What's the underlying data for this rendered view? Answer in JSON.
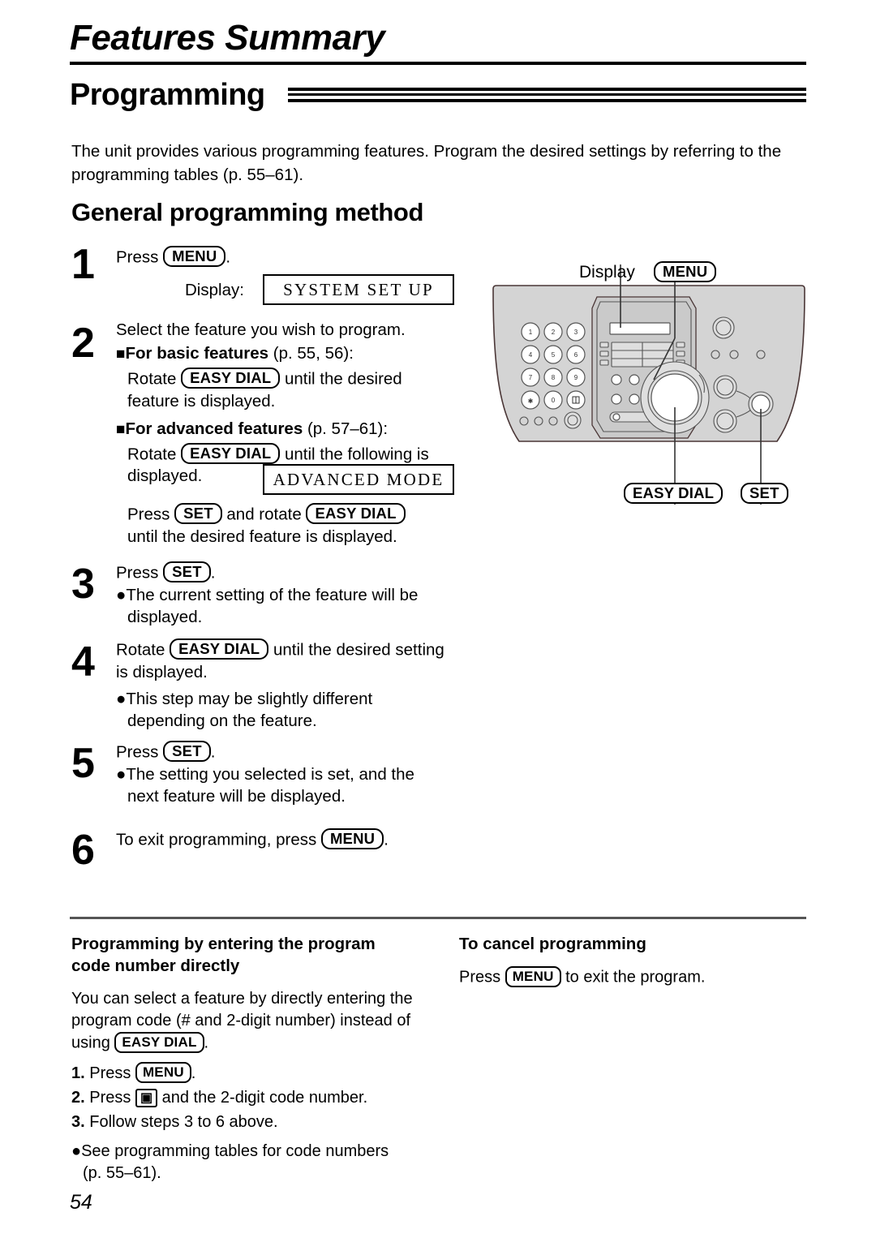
{
  "header": {
    "chapter_title": "Features Summary",
    "section_title": "Programming"
  },
  "intro": {
    "paragraph": "The unit provides various programming features. Program the desired settings by referring to the programming tables (p. 55–61)."
  },
  "subsection": {
    "title": "General programming method"
  },
  "keys": {
    "menu": "MENU",
    "set": "SET",
    "easy_dial": "EASY DIAL",
    "hash": "▣"
  },
  "steps": [
    {
      "number": "1",
      "line1_prefix": "Press",
      "line1_key": "MENU",
      "line1_suffix": ".",
      "display_label": "Display:",
      "display_text": "SYSTEM SET UP"
    },
    {
      "number": "2",
      "line1": "Select the feature you wish to program.",
      "basic_heading": "For basic features",
      "basic_pages": "(p. 55, 56):",
      "basic_l1_prefix": "Rotate",
      "basic_l1_key": "EASY DIAL",
      "basic_l1_suffix": "until the desired",
      "basic_l2": "feature is displayed.",
      "advanced_heading": "For advanced features",
      "advanced_pages": "(p. 57–61):",
      "advanced_l1_prefix": "Rotate",
      "advanced_l1_key": "EASY DIAL",
      "advanced_l1_suffix": "until the following is",
      "advanced_l2": "displayed.",
      "display_text": "ADVANCED MODE",
      "press_prefix": "Press",
      "press_key1": "SET",
      "press_middle": "and rotate",
      "press_key2": "EASY DIAL",
      "press_l2": "until the desired feature is displayed."
    },
    {
      "number": "3",
      "line1_prefix": "Press",
      "line1_key": "SET",
      "line1_suffix": ".",
      "bullet1": "●The current setting of the feature will be",
      "bullet1_cont": "displayed."
    },
    {
      "number": "4",
      "line1_prefix": "Rotate",
      "line1_key": "EASY DIAL",
      "line1_suffix": "until the desired setting",
      "line2": "is displayed.",
      "bullet1": "●This step may be slightly different",
      "bullet1_cont": "depending on the feature."
    },
    {
      "number": "5",
      "line1_prefix": "Press",
      "line1_key": "SET",
      "line1_suffix": ".",
      "bullet1": "●The setting you selected is set, and the",
      "bullet1_cont": "next feature will be displayed."
    },
    {
      "number": "6",
      "line1_prefix": "To exit programming, press",
      "line1_key": "MENU",
      "line1_suffix": "."
    }
  ],
  "device": {
    "callout_display": "Display",
    "callout_menu": "MENU",
    "callout_easy_dial": "EASY DIAL",
    "callout_set": "SET",
    "keypad": [
      "1",
      "2",
      "3",
      "4",
      "5",
      "6",
      "7",
      "8",
      "9",
      "✱",
      "0",
      "▣"
    ],
    "body_color": "#d4d4d4",
    "panel_color": "#cfcfcf",
    "outline_color": "#3d2b2b"
  },
  "bottom": {
    "left": {
      "heading_l1": "Programming by entering the program",
      "heading_l2": "code number directly",
      "body_l1": "You can select a feature by directly entering the",
      "body_l2": "program code (# and 2-digit number) instead of",
      "body_l3_prefix": "using",
      "body_l3_key": "EASY DIAL",
      "body_l3_suffix": ".",
      "item1_num": "1.",
      "item1_prefix": "Press",
      "item1_key": "MENU",
      "item1_suffix": ".",
      "item2_num": "2.",
      "item2_prefix": "Press",
      "item2_key": "▣",
      "item2_suffix": "and the 2-digit code number.",
      "item3_num": "3.",
      "item3_text": "Follow steps 3 to 6 above.",
      "note_l1": "●See programming tables for code numbers",
      "note_l2": "(p. 55–61)."
    },
    "right": {
      "heading": "To cancel programming",
      "body_prefix": "Press",
      "body_key": "MENU",
      "body_suffix": "to exit the program."
    }
  },
  "page_number": "54"
}
